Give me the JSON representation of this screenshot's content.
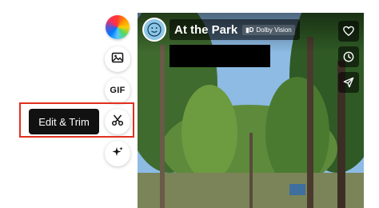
{
  "toolbar": {
    "gif_label": "GIF",
    "edit_trim_tooltip": "Edit & Trim",
    "icons": [
      "color-wheel",
      "image-icon",
      "gif",
      "scissors-icon",
      "sparkle-icon"
    ]
  },
  "post": {
    "title": "At the Park",
    "dolby_mark": "▮D",
    "dolby_label": "Dolby Vision",
    "side_icons": [
      "heart-icon",
      "clock-icon",
      "send-icon"
    ]
  },
  "colors": {
    "highlight": "#e0301e",
    "tooltip_bg": "#111111"
  }
}
